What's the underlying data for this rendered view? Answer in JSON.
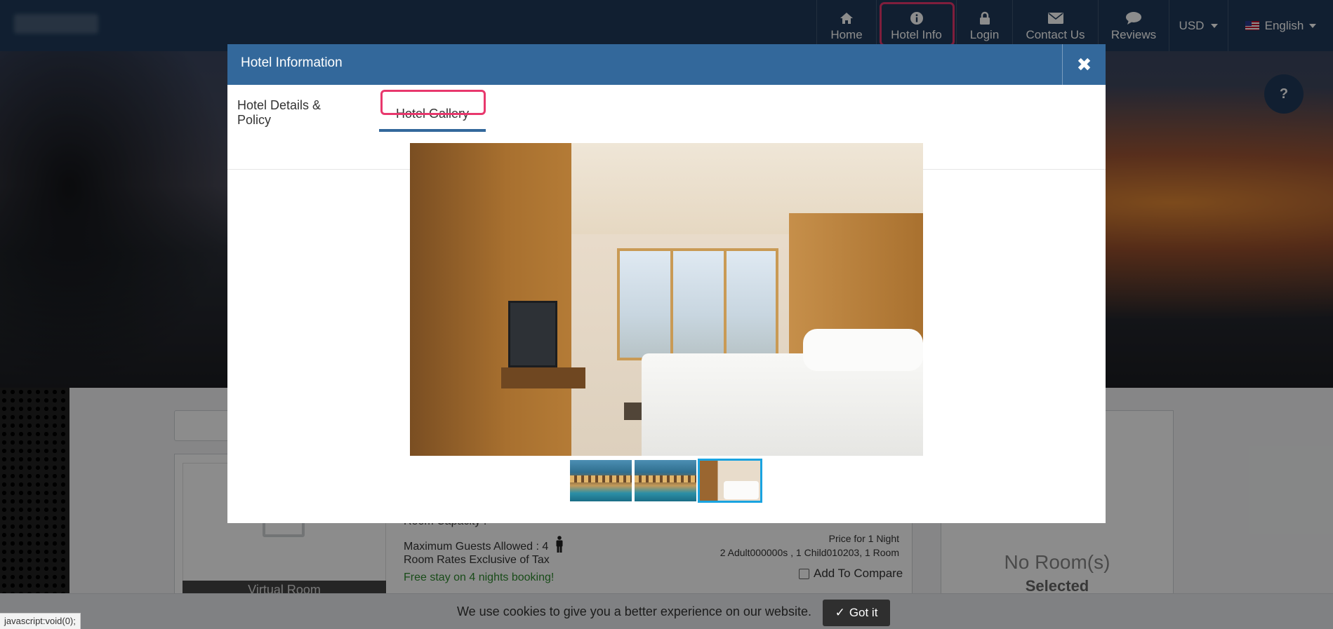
{
  "nav": {
    "home": "Home",
    "hotel_info": "Hotel Info",
    "login": "Login",
    "contact": "Contact Us",
    "reviews": "Reviews",
    "currency": "USD",
    "language": "English"
  },
  "help_icon": "?",
  "modal": {
    "title": "Hotel Information",
    "close": "✖",
    "tabs": [
      "Hotel Details & Policy",
      "Hotel Gallery"
    ],
    "active_tab": "Hotel Gallery",
    "gallery": {
      "thumbnails": [
        "pool-exterior",
        "pool-exterior",
        "guest-room"
      ],
      "active_index": 2
    }
  },
  "room": {
    "image_caption": "Virtual Room",
    "capacity_label": "Room Capacity :",
    "max_guests_label": "Maximum Guests Allowed :",
    "max_guests_value": "4",
    "tax_note": "Room Rates Exclusive of Tax",
    "promo": "Free stay on 4 nights booking!",
    "price_for": "Price for 1 Night",
    "guests_summary": "2 Adult000000s , 1 Child010203, 1 Room",
    "compare_label": "Add To Compare"
  },
  "summary": {
    "no_room": "No Room(s)",
    "selected": "Selected"
  },
  "cookie": {
    "message": "We use cookies to give you a better experience on our website.",
    "button": "Got it"
  },
  "status_url": "javascript:void(0);",
  "colors": {
    "topbar": "#1f3a5a",
    "modal_header": "#33689b",
    "highlight": "#e8386d",
    "thumb_active": "#1aa3e0",
    "promo_green": "#2e8b2e"
  }
}
